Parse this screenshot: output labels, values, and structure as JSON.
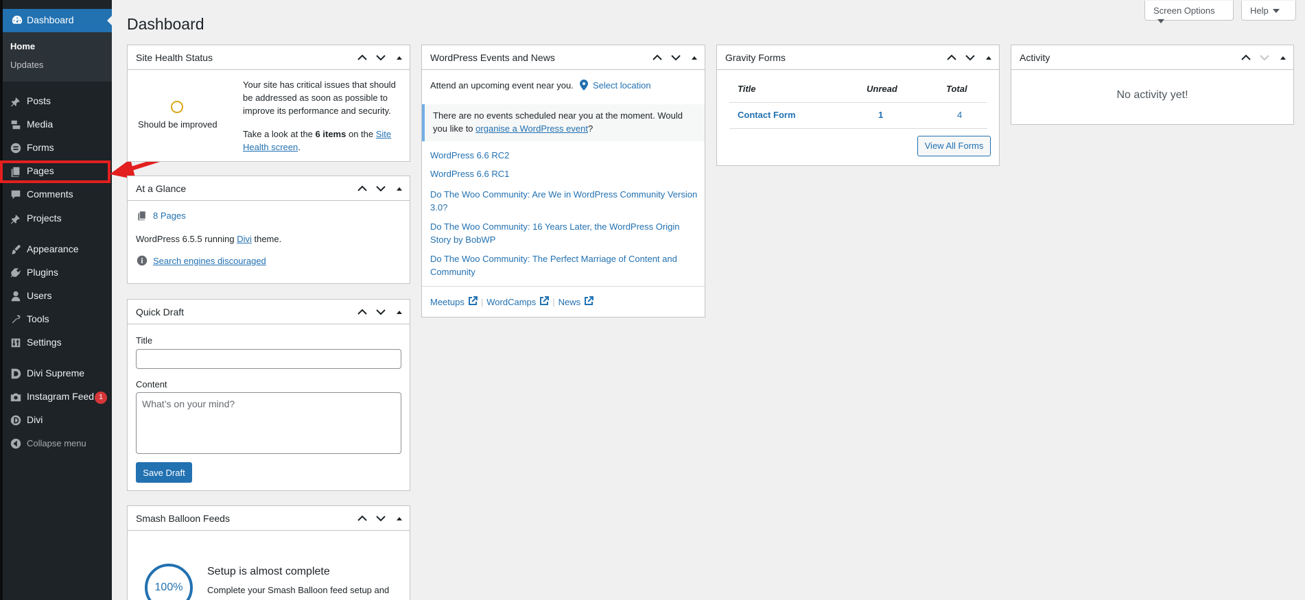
{
  "sidebar": {
    "dashboard_label": "Dashboard",
    "submenu": [
      "Home",
      "Updates"
    ],
    "items": [
      {
        "label": "Posts",
        "icon": "pin-icon"
      },
      {
        "label": "Media",
        "icon": "media-icon"
      },
      {
        "label": "Forms",
        "icon": "forms-icon"
      },
      {
        "label": "Pages",
        "icon": "pages-icon"
      },
      {
        "label": "Comments",
        "icon": "comments-icon"
      },
      {
        "label": "Projects",
        "icon": "pin-icon"
      },
      {
        "label": "Appearance",
        "icon": "brush-icon"
      },
      {
        "label": "Plugins",
        "icon": "plugin-icon"
      },
      {
        "label": "Users",
        "icon": "user-icon"
      },
      {
        "label": "Tools",
        "icon": "wrench-icon"
      },
      {
        "label": "Settings",
        "icon": "settings-icon"
      },
      {
        "label": "Divi Supreme",
        "icon": "divi-supreme-icon"
      },
      {
        "label": "Instagram Feed",
        "icon": "camera-icon",
        "badge": "1"
      },
      {
        "label": "Divi",
        "icon": "divi-icon"
      }
    ],
    "collapse_label": "Collapse menu"
  },
  "header": {
    "title": "Dashboard",
    "screen_options": "Screen Options",
    "help": "Help"
  },
  "site_health": {
    "title": "Site Health Status",
    "status": "Should be improved",
    "message": "Your site has critical issues that should be addressed as soon as possible to improve its performance and security.",
    "take_look_prefix": "Take a look at the",
    "items_count": "6 items",
    "on_the": "on the",
    "link": "Site Health screen",
    "period": "."
  },
  "at_a_glance": {
    "title": "At a Glance",
    "pages": "8 Pages",
    "wp_running_prefix": "WordPress 6.5.5 running",
    "theme_link": "Divi",
    "theme_suffix": "theme.",
    "search_engines": "Search engines discouraged"
  },
  "quick_draft": {
    "title": "Quick Draft",
    "title_label": "Title",
    "title_value": "",
    "content_label": "Content",
    "content_placeholder": "What’s on your mind?",
    "save_button": "Save Draft"
  },
  "smash_balloon": {
    "title": "Smash Balloon Feeds",
    "percent": "100%",
    "heading": "Setup is almost complete",
    "text": "Complete your Smash Balloon feed setup and"
  },
  "events": {
    "title": "WordPress Events and News",
    "attend": "Attend an upcoming event near you.",
    "select_location": "Select location",
    "no_events_prefix": "There are no events scheduled near you at the moment. Would you like to",
    "organise_link": "organise a WordPress event",
    "no_events_suffix": "?",
    "news": [
      "WordPress 6.6 RC2",
      "WordPress 6.6 RC1",
      "Do The Woo Community: Are We in WordPress Community Version 3.0?",
      "Do The Woo Community: 16 Years Later, the WordPress Origin Story by BobWP",
      "Do The Woo Community: The Perfect Marriage of Content and Community"
    ],
    "footer": [
      "Meetups",
      "WordCamps",
      "News"
    ],
    "separator": "|"
  },
  "gravity_forms": {
    "title": "Gravity Forms",
    "columns": [
      "Title",
      "Unread",
      "Total"
    ],
    "rows": [
      {
        "title": "Contact Form",
        "unread": "1",
        "total": "4"
      }
    ],
    "view_all": "View All Forms"
  },
  "activity": {
    "title": "Activity",
    "empty": "No activity yet!"
  },
  "colors": {
    "sidebar_bg": "#1d2327",
    "accent": "#2271b1",
    "highlight_red": "#e31f1f",
    "warning": "#dba617"
  }
}
